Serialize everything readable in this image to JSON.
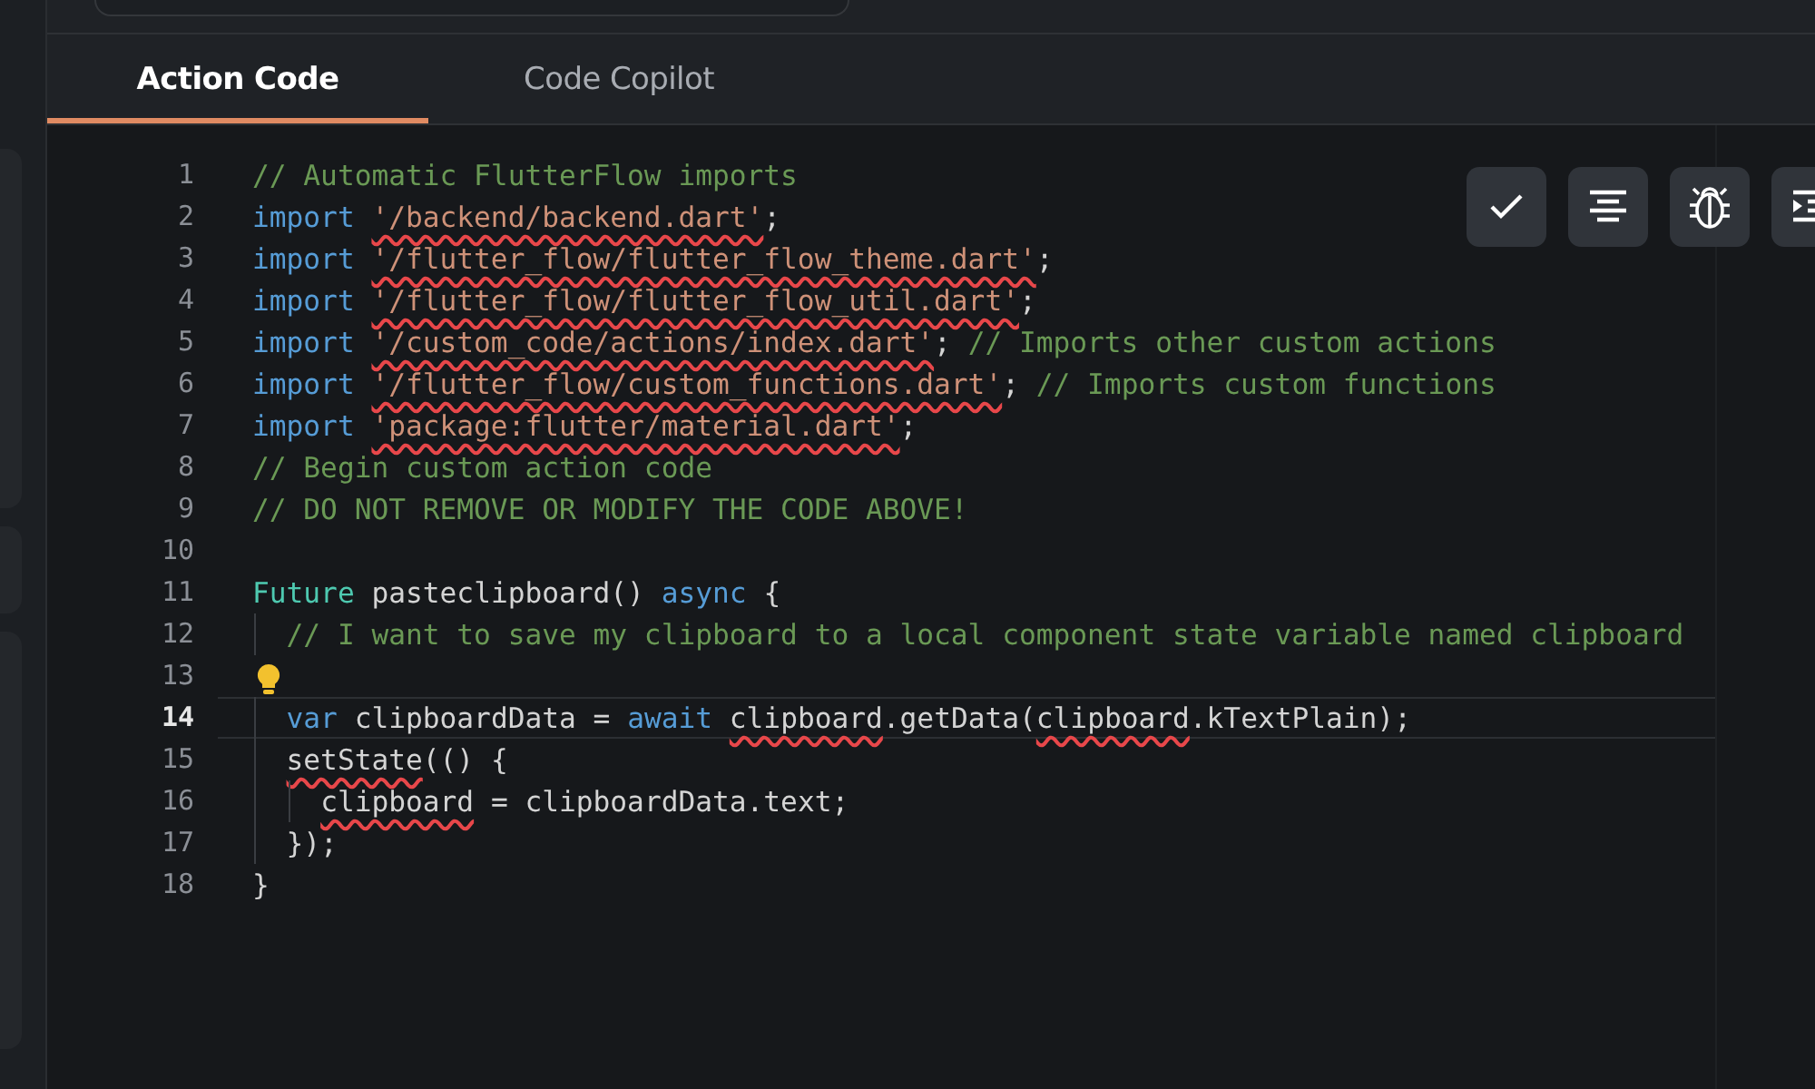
{
  "tabs": [
    {
      "label": "Action Code",
      "selected": true
    },
    {
      "label": "Code Copilot",
      "selected": false
    }
  ],
  "toolbar": [
    {
      "kind": "check"
    },
    {
      "kind": "format"
    },
    {
      "kind": "debug"
    },
    {
      "kind": "indent"
    }
  ],
  "lines": [
    {
      "number": "1",
      "current": false,
      "bulb": false,
      "tokens": [
        {
          "text": "// Automatic FlutterFlow imports",
          "kind": "comment",
          "error": false
        }
      ]
    },
    {
      "number": "2",
      "current": false,
      "bulb": false,
      "tokens": [
        {
          "text": "import ",
          "kind": "keyword",
          "error": false
        },
        {
          "text": "'/backend/backend.dart'",
          "kind": "string",
          "error": true
        },
        {
          "text": ";",
          "kind": "plain",
          "error": false
        }
      ]
    },
    {
      "number": "3",
      "current": false,
      "bulb": false,
      "tokens": [
        {
          "text": "import ",
          "kind": "keyword",
          "error": false
        },
        {
          "text": "'/flutter_flow/flutter_flow_theme.dart'",
          "kind": "string",
          "error": true
        },
        {
          "text": ";",
          "kind": "plain",
          "error": false
        }
      ]
    },
    {
      "number": "4",
      "current": false,
      "bulb": false,
      "tokens": [
        {
          "text": "import ",
          "kind": "keyword",
          "error": false
        },
        {
          "text": "'/flutter_flow/flutter_flow_util.dart'",
          "kind": "string",
          "error": true
        },
        {
          "text": ";",
          "kind": "plain",
          "error": false
        }
      ]
    },
    {
      "number": "5",
      "current": false,
      "bulb": false,
      "tokens": [
        {
          "text": "import ",
          "kind": "keyword",
          "error": false
        },
        {
          "text": "'/custom_code/actions/index.dart'",
          "kind": "string",
          "error": true
        },
        {
          "text": "; ",
          "kind": "plain",
          "error": false
        },
        {
          "text": "// Imports other custom actions",
          "kind": "comment",
          "error": false
        }
      ]
    },
    {
      "number": "6",
      "current": false,
      "bulb": false,
      "tokens": [
        {
          "text": "import ",
          "kind": "keyword",
          "error": false
        },
        {
          "text": "'/flutter_flow/custom_functions.dart'",
          "kind": "string",
          "error": true
        },
        {
          "text": "; ",
          "kind": "plain",
          "error": false
        },
        {
          "text": "// Imports custom functions",
          "kind": "comment",
          "error": false
        }
      ]
    },
    {
      "number": "7",
      "current": false,
      "bulb": false,
      "tokens": [
        {
          "text": "import ",
          "kind": "keyword",
          "error": false
        },
        {
          "text": "'package:flutter/material.dart'",
          "kind": "string",
          "error": true
        },
        {
          "text": ";",
          "kind": "plain",
          "error": false
        }
      ]
    },
    {
      "number": "8",
      "current": false,
      "bulb": false,
      "tokens": [
        {
          "text": "// Begin custom action code",
          "kind": "comment",
          "error": false
        }
      ]
    },
    {
      "number": "9",
      "current": false,
      "bulb": false,
      "tokens": [
        {
          "text": "// DO NOT REMOVE OR MODIFY THE CODE ABOVE!",
          "kind": "comment",
          "error": false
        }
      ]
    },
    {
      "number": "10",
      "current": false,
      "bulb": false
    },
    {
      "number": "11",
      "current": false,
      "bulb": false,
      "tokens": [
        {
          "text": "Future",
          "kind": "type",
          "error": false
        },
        {
          "text": " pasteclipboard() ",
          "kind": "plain",
          "error": false
        },
        {
          "text": "async",
          "kind": "keyword",
          "error": false
        },
        {
          "text": " {",
          "kind": "plain",
          "error": false
        }
      ]
    },
    {
      "number": "12",
      "current": false,
      "bulb": false,
      "tokens": [
        {
          "text": "  // I want to save my clipboard to a local component state variable named clipboard",
          "kind": "comment",
          "error": false
        }
      ]
    },
    {
      "number": "13",
      "current": false,
      "bulb": true
    },
    {
      "number": "14",
      "current": true,
      "bulb": false,
      "tokens": [
        {
          "text": "  var ",
          "kind": "keyword",
          "error": false
        },
        {
          "text": "clipboardData = ",
          "kind": "plain",
          "error": false
        },
        {
          "text": "await ",
          "kind": "keyword",
          "error": false
        },
        {
          "text": "clipboard",
          "kind": "plain",
          "error": true
        },
        {
          "text": ".getData(",
          "kind": "plain",
          "error": false
        },
        {
          "text": "clipboard",
          "kind": "plain",
          "error": true
        },
        {
          "text": ".kTextPlain);",
          "kind": "plain",
          "error": false
        }
      ]
    },
    {
      "number": "15",
      "current": false,
      "bulb": false,
      "tokens": [
        {
          "text": "  setState",
          "kind": "plain",
          "error": true
        },
        {
          "text": "(() {",
          "kind": "plain",
          "error": false
        }
      ]
    },
    {
      "number": "16",
      "current": false,
      "bulb": false,
      "tokens": [
        {
          "text": "    clipboard",
          "kind": "plain",
          "error": true
        },
        {
          "text": " = clipboardData.text;",
          "kind": "plain",
          "error": false
        }
      ]
    },
    {
      "number": "17",
      "current": false,
      "bulb": false,
      "tokens": [
        {
          "text": "  });",
          "kind": "plain",
          "error": false
        }
      ]
    },
    {
      "number": "18",
      "current": false,
      "bulb": false,
      "tokens": [
        {
          "text": "}",
          "kind": "plain",
          "error": false
        }
      ]
    }
  ]
}
